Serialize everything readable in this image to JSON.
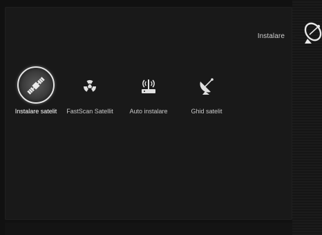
{
  "header": {
    "title": "Instalare",
    "icon": "satellite-dish-icon"
  },
  "menu": {
    "items": [
      {
        "label": "Instalare satelit",
        "icon": "satellite-icon",
        "selected": true
      },
      {
        "label": "FastScan Satellit",
        "icon": "radiation-icon",
        "selected": false
      },
      {
        "label": "Auto instalare",
        "icon": "antenna-receiver-icon",
        "selected": false
      },
      {
        "label": "Ghid satelit",
        "icon": "dish-guide-icon",
        "selected": false
      }
    ]
  },
  "colors": {
    "background": "#111111",
    "panel": "#191919",
    "text": "#c9c9c9",
    "selected_text": "#ffffff"
  }
}
